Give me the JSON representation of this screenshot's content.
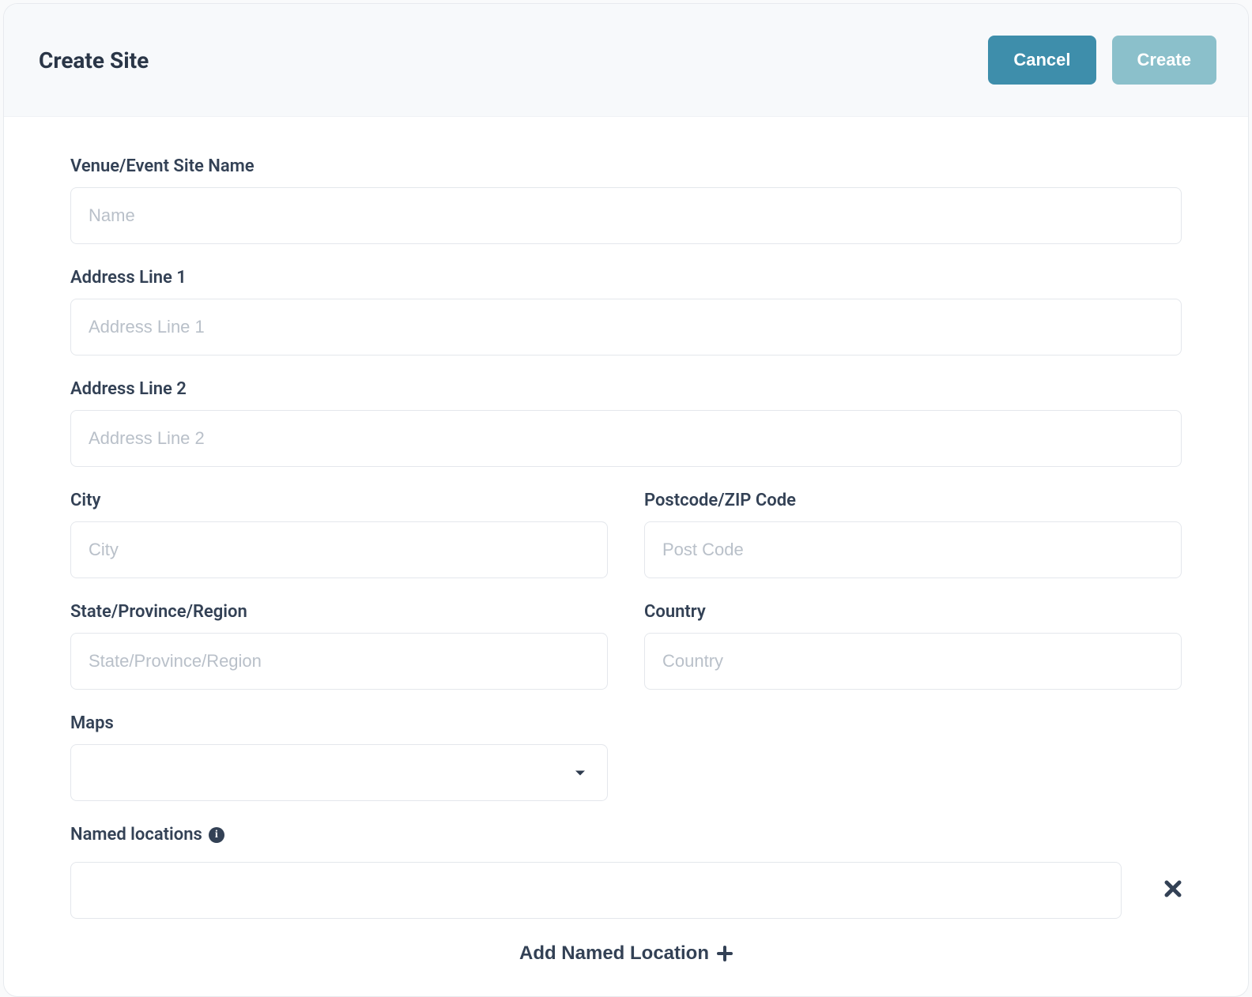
{
  "header": {
    "title": "Create Site",
    "cancel_label": "Cancel",
    "create_label": "Create"
  },
  "form": {
    "site_name_label": "Venue/Event Site Name",
    "site_name_placeholder": "Name",
    "site_name_value": "",
    "addr1_label": "Address Line 1",
    "addr1_placeholder": "Address Line 1",
    "addr1_value": "",
    "addr2_label": "Address Line 2",
    "addr2_placeholder": "Address Line 2",
    "addr2_value": "",
    "city_label": "City",
    "city_placeholder": "City",
    "city_value": "",
    "postcode_label": "Postcode/ZIP Code",
    "postcode_placeholder": "Post Code",
    "postcode_value": "",
    "state_label": "State/Province/Region",
    "state_placeholder": "State/Province/Region",
    "state_value": "",
    "country_label": "Country",
    "country_placeholder": "Country",
    "country_value": "",
    "maps_label": "Maps",
    "maps_value": "",
    "named_locations_label": "Named locations",
    "named_location_value": "",
    "add_named_label": "Add Named Location"
  },
  "icons": {
    "info": "info-icon",
    "remove": "close-icon",
    "caret": "caret-down-icon",
    "plus": "plus-icon"
  }
}
